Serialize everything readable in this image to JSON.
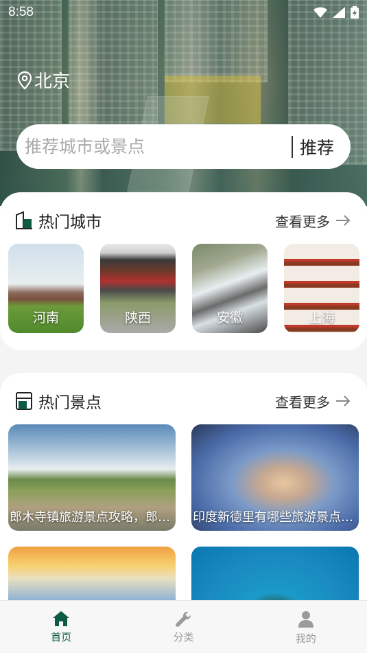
{
  "status": {
    "time": "8:58"
  },
  "location": {
    "city": "北京"
  },
  "search": {
    "placeholder": "推荐城市或景点",
    "button": "推荐"
  },
  "hot_cities": {
    "title": "热门城市",
    "more": "查看更多",
    "items": [
      {
        "label": "河南"
      },
      {
        "label": "陕西"
      },
      {
        "label": "安徽"
      },
      {
        "label": "上海"
      }
    ]
  },
  "hot_spots": {
    "title": "热门景点",
    "more": "查看更多",
    "items": [
      {
        "label": "郎木寺镇旅游景点攻略，郎木寺镇必游景点"
      },
      {
        "label": "印度新德里有哪些旅游景点推荐"
      },
      {
        "label": ""
      },
      {
        "label": ""
      }
    ]
  },
  "tabs": [
    {
      "label": "首页",
      "active": true
    },
    {
      "label": "分类",
      "active": false
    },
    {
      "label": "我的",
      "active": false
    }
  ],
  "colors": {
    "accent": "#0d5a45",
    "inactive": "#9a9a9a"
  }
}
